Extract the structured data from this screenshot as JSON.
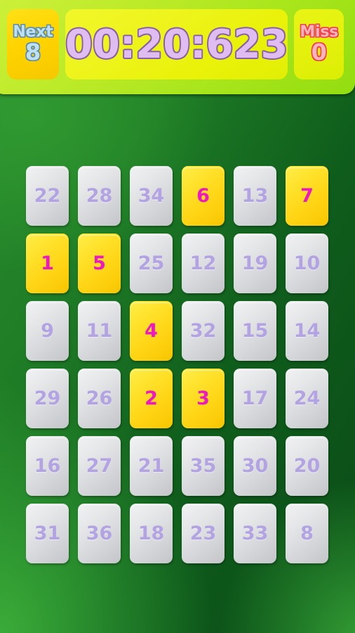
{
  "header": {
    "next": {
      "label": "Next",
      "value": "8"
    },
    "timer": {
      "value": "00:20:623"
    },
    "miss": {
      "label": "Miss",
      "value": "0"
    }
  },
  "colors": {
    "background_green_light": "#3caf3a",
    "background_green_dark": "#0a4b17",
    "header_green": "#b9ea26",
    "next_panel": "#ffd400",
    "timer_panel": "#eef41c",
    "miss_panel": "#e4f10c",
    "next_text": "#bfe0f2",
    "next_outline": "#5d8ea8",
    "timer_text": "#e0bdf0",
    "timer_outline": "#8a5fa8",
    "miss_text": "#ffb4bd",
    "miss_outline": "#f0404a",
    "tile_plain": "#e0e2e5",
    "tile_plain_text": "#b3a3e2",
    "tile_active": "#ffd414",
    "tile_active_text": "#ee18c0"
  },
  "grid": {
    "rows": 6,
    "cols": 6,
    "tiles": [
      {
        "value": "22",
        "state": "plain"
      },
      {
        "value": "28",
        "state": "plain"
      },
      {
        "value": "34",
        "state": "plain"
      },
      {
        "value": "6",
        "state": "active"
      },
      {
        "value": "13",
        "state": "plain"
      },
      {
        "value": "7",
        "state": "active"
      },
      {
        "value": "1",
        "state": "active"
      },
      {
        "value": "5",
        "state": "active"
      },
      {
        "value": "25",
        "state": "plain"
      },
      {
        "value": "12",
        "state": "plain"
      },
      {
        "value": "19",
        "state": "plain"
      },
      {
        "value": "10",
        "state": "plain"
      },
      {
        "value": "9",
        "state": "plain"
      },
      {
        "value": "11",
        "state": "plain"
      },
      {
        "value": "4",
        "state": "active"
      },
      {
        "value": "32",
        "state": "plain"
      },
      {
        "value": "15",
        "state": "plain"
      },
      {
        "value": "14",
        "state": "plain"
      },
      {
        "value": "29",
        "state": "plain"
      },
      {
        "value": "26",
        "state": "plain"
      },
      {
        "value": "2",
        "state": "active"
      },
      {
        "value": "3",
        "state": "active"
      },
      {
        "value": "17",
        "state": "plain"
      },
      {
        "value": "24",
        "state": "plain"
      },
      {
        "value": "16",
        "state": "plain"
      },
      {
        "value": "27",
        "state": "plain"
      },
      {
        "value": "21",
        "state": "plain"
      },
      {
        "value": "35",
        "state": "plain"
      },
      {
        "value": "30",
        "state": "plain"
      },
      {
        "value": "20",
        "state": "plain"
      },
      {
        "value": "31",
        "state": "plain"
      },
      {
        "value": "36",
        "state": "plain"
      },
      {
        "value": "18",
        "state": "plain"
      },
      {
        "value": "23",
        "state": "plain"
      },
      {
        "value": "33",
        "state": "plain"
      },
      {
        "value": "8",
        "state": "plain"
      }
    ]
  }
}
